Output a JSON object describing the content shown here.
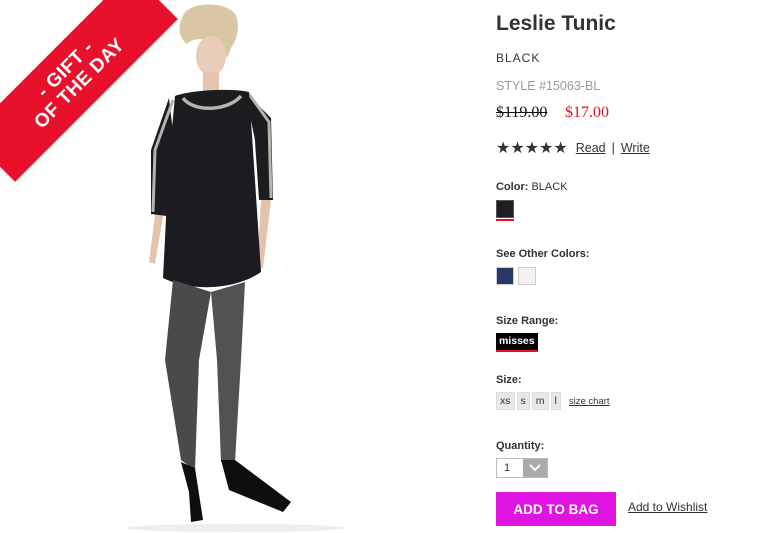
{
  "promo": {
    "line1": "- GIFT -",
    "line2": "OF THE DAY"
  },
  "product": {
    "title": "Leslie Tunic",
    "color_name": "BLACK",
    "style": "STYLE #15063-BL",
    "old_price": "$119.00",
    "new_price": "$17.00",
    "rating_stars": 5,
    "stars_glyph": "★★★★★",
    "read_label": "Read",
    "sep": "|",
    "write_label": "Write"
  },
  "color": {
    "label": "Color:",
    "value": "BLACK",
    "selected_hex": "#1f1d22"
  },
  "other_colors": {
    "label": "See Other Colors:",
    "swatches": [
      "#28386a",
      "#f2f2f2"
    ]
  },
  "size_range": {
    "label": "Size Range:",
    "selected": "misses"
  },
  "size": {
    "label": "Size:",
    "options": [
      "xs",
      "s",
      "m",
      "l"
    ],
    "chart_label": "size chart"
  },
  "quantity": {
    "label": "Quantity:",
    "value": "1"
  },
  "actions": {
    "add_to_bag": "ADD TO BAG",
    "wishlist": "Add to Wishlist"
  },
  "colors": {
    "accent_red": "#e8102a",
    "cta_magenta": "#e014e0"
  }
}
